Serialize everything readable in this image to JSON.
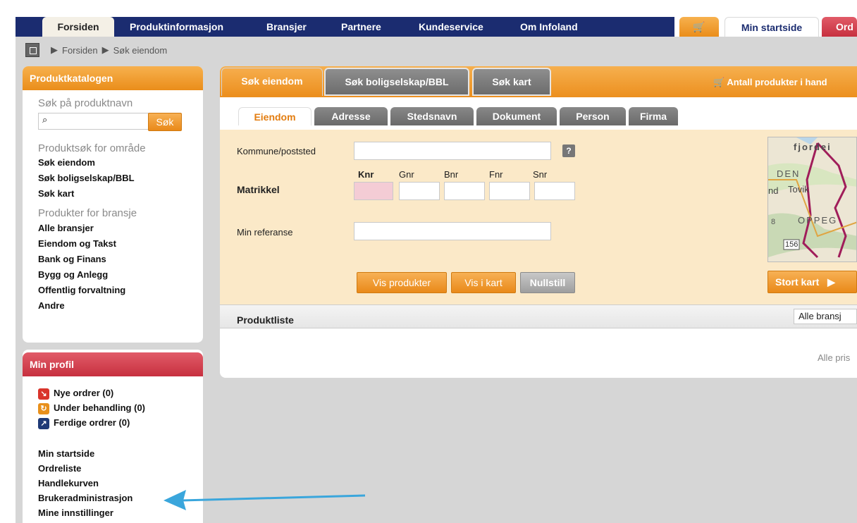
{
  "nav": {
    "tabs": [
      "Forsiden",
      "Produktinformasjon",
      "Bransjer",
      "Partnere",
      "Kundeservice",
      "Om Infoland"
    ],
    "right_tabs": [
      "Min startside",
      "Ord"
    ],
    "cart_icon": "cart-icon"
  },
  "breadcrumb": {
    "items": [
      "Forsiden",
      "Søk eiendom"
    ]
  },
  "produktkatalog": {
    "title": "Produktkatalogen",
    "search_label": "Søk på produktnavn",
    "search_value": "",
    "search_button": "Søk",
    "area_heading": "Produktsøk for område",
    "area_links": [
      "Søk eiendom",
      "Søk boligselskap/BBL",
      "Søk kart"
    ],
    "industry_heading": "Produkter for bransje",
    "industry_links": [
      "Alle bransjer",
      "Eiendom og Takst",
      "Bank og Finans",
      "Bygg og Anlegg",
      "Offentlig forvaltning",
      "Andre"
    ]
  },
  "profil": {
    "title": "Min profil",
    "orders": [
      {
        "label": "Nye ordrer (0)",
        "color": "#d9342b",
        "icon": "new-orders-icon"
      },
      {
        "label": "Under behandling (0)",
        "color": "#e8901c",
        "icon": "processing-icon"
      },
      {
        "label": "Ferdige ordrer (0)",
        "color": "#1f3a77",
        "icon": "done-orders-icon"
      }
    ],
    "links": [
      "Min startside",
      "Ordreliste",
      "Handlekurven",
      "Brukeradministrasjon",
      "Mine innstillinger"
    ]
  },
  "main": {
    "tabs": [
      "Søk eiendom",
      "Søk boligselskap/BBL",
      "Søk kart"
    ],
    "cart_info": "Antall produkter i hand",
    "subtabs": [
      "Eiendom",
      "Adresse",
      "Stedsnavn",
      "Dokument",
      "Person",
      "Firma"
    ],
    "form": {
      "kommune_label": "Kommune/poststed",
      "kommune_value": "",
      "matrikkel_label": "Matrikkel",
      "matrikkel_cols": [
        "Knr",
        "Gnr",
        "Bnr",
        "Fnr",
        "Snr"
      ],
      "referanse_label": "Min referanse",
      "referanse_value": "",
      "help_label": "?"
    },
    "buttons": {
      "vis_produkter": "Vis produkter",
      "vis_i_kart": "Vis i kart",
      "nullstill": "Nullstill"
    },
    "map": {
      "labels": [
        "fjordei",
        "DEN",
        "nd",
        "Tovik",
        "OPPEG",
        "8",
        "156"
      ],
      "stort_kart": "Stort kart"
    },
    "produktliste": {
      "title": "Produktliste",
      "filter_value": "Alle bransj",
      "footer_text": "Alle pris"
    }
  },
  "colors": {
    "nav": "#1b2c70",
    "orange": "#ec8f1e",
    "red": "#c7303f",
    "arrow": "#3aa6dc"
  }
}
